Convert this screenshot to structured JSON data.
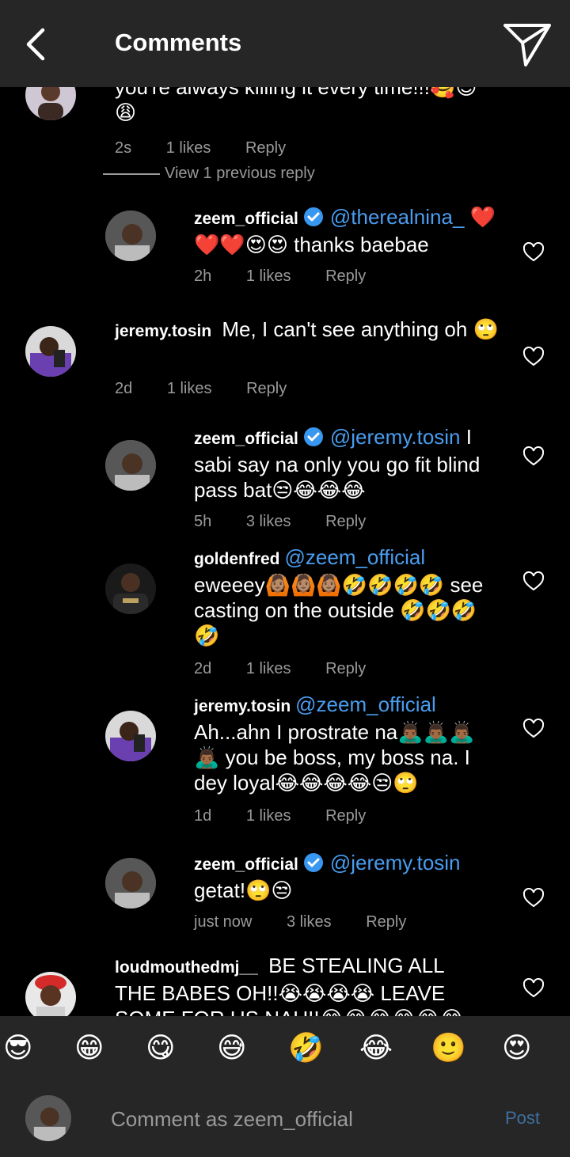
{
  "header": {
    "title": "Comments"
  },
  "comments": [
    {
      "user": "",
      "verified": false,
      "mention": "",
      "text": "you're always killing it every time!!!🥰😍😩",
      "time": "2s",
      "likes": "1 likes",
      "reply": "Reply",
      "view_previous": "View 1 previous reply"
    },
    {
      "user": "zeem_official",
      "verified": true,
      "mention": "@therealnina_",
      "text": "❤️❤️❤️😍😍 thanks baebae",
      "time": "2h",
      "likes": "1 likes",
      "reply": "Reply"
    },
    {
      "user": "jeremy.tosin",
      "verified": false,
      "mention": "",
      "text": "Me, I can't see anything oh 🙄",
      "time": "2d",
      "likes": "1 likes",
      "reply": "Reply"
    },
    {
      "user": "zeem_official",
      "verified": true,
      "mention": "@jeremy.tosin",
      "text": "I sabi say na only you go fit blind pass bat😒😂😂😂",
      "time": "5h",
      "likes": "3 likes",
      "reply": "Reply"
    },
    {
      "user": "goldenfred",
      "verified": false,
      "mention": "@zeem_official",
      "text": "eweeey🙆🏽🙆🏽🙆🏽🤣🤣🤣🤣 see casting on the outside 🤣🤣🤣🤣",
      "time": "2d",
      "likes": "1 likes",
      "reply": "Reply"
    },
    {
      "user": "jeremy.tosin",
      "verified": false,
      "mention": "@zeem_official",
      "text": "Ah...ahn I prostrate na🙇🏾‍♂️🙇🏾‍♂️🙇🏾‍♂️🙇🏾‍♂️ you be boss, my boss na. I dey loyal😂😂😂😂😒🙄",
      "time": "1d",
      "likes": "1 likes",
      "reply": "Reply"
    },
    {
      "user": "zeem_official",
      "verified": true,
      "mention": "@jeremy.tosin",
      "text": "getat!🙄😒",
      "time": "just now",
      "likes": "3 likes",
      "reply": "Reply"
    },
    {
      "user": "loudmouthedmj__",
      "verified": false,
      "mention": "",
      "text": "BE STEALING ALL THE BABES OH!!😭😭😭😭 LEAVE SOME FOR US NAU!!😂😂😂😂😂😂",
      "time": "",
      "likes": "",
      "reply": ""
    }
  ],
  "emoji_bar": [
    "😎",
    "😁",
    "😋",
    "😅",
    "🤣",
    "😂",
    "🙂",
    "😍"
  ],
  "input": {
    "placeholder": "Comment as zeem_official",
    "post_label": "Post"
  },
  "icons": {
    "back": "back-arrow-icon",
    "send": "paper-plane-icon",
    "like": "heart-icon",
    "verified": "verified-badge-icon"
  },
  "colors": {
    "background": "#000000",
    "bar": "#262626",
    "mention": "#4a9df0",
    "muted": "#9a9a9a",
    "verified": "#3897f0",
    "post": "#3f6f9f"
  }
}
